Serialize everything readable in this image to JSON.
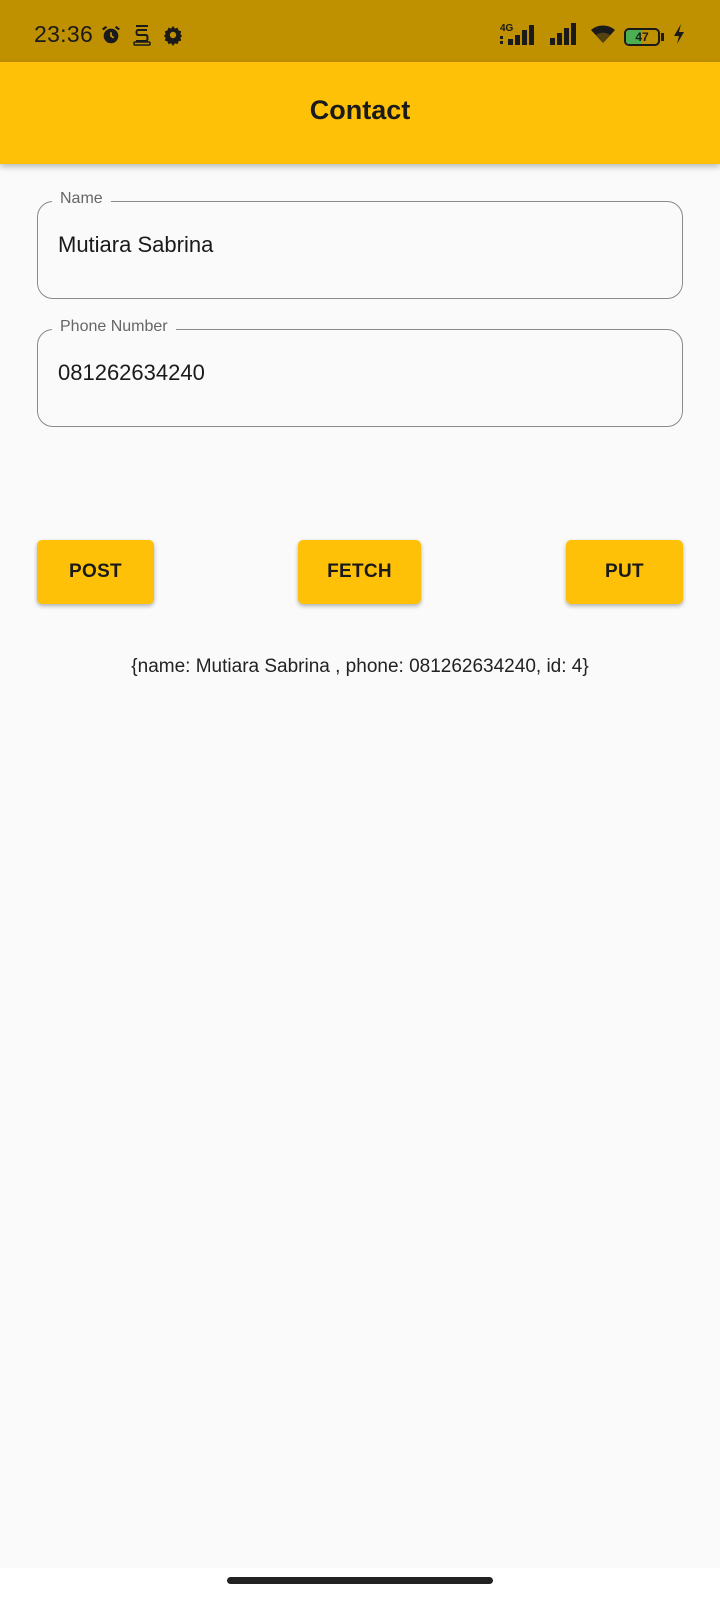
{
  "status_bar": {
    "time": "23:36",
    "battery_level": "47",
    "battery_fraction": 0.47,
    "network_type": "4G",
    "icons": [
      "alarm-icon",
      "app-notification-icon",
      "settings-icon",
      "signal-4g-icon",
      "signal-icon",
      "wifi-icon",
      "battery-icon",
      "charging-icon"
    ]
  },
  "app_bar": {
    "title": "Contact"
  },
  "form": {
    "name": {
      "label": "Name",
      "value": "Mutiara Sabrina"
    },
    "phone": {
      "label": "Phone Number",
      "value": "081262634240"
    }
  },
  "buttons": {
    "post": "POST",
    "fetch": "FETCH",
    "put": "PUT"
  },
  "result": "{name: Mutiara Sabrina , phone: 081262634240, id: 4}",
  "colors": {
    "accent": "#ffc107",
    "status_bar": "#bf9000",
    "background": "#fafafa"
  }
}
